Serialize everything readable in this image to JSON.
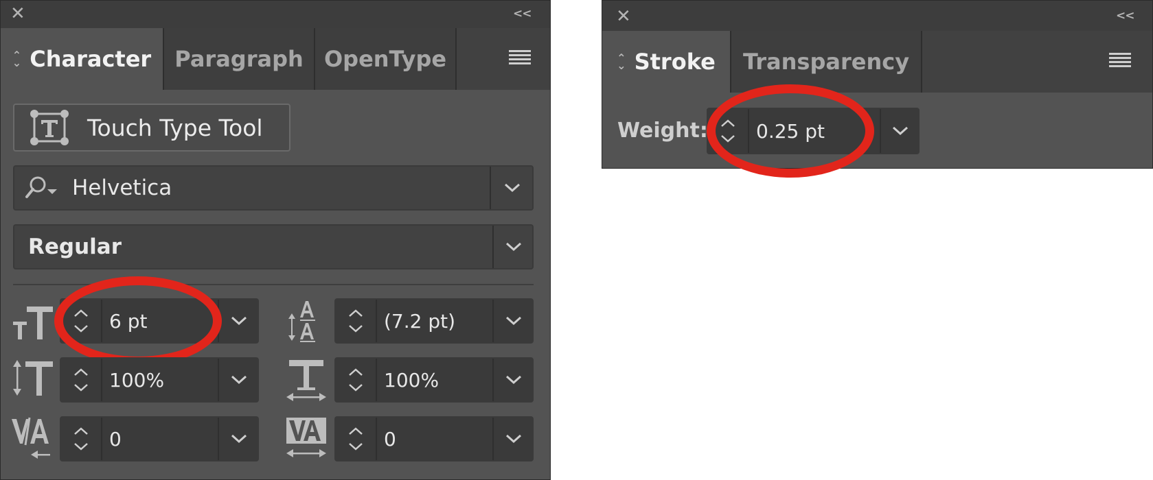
{
  "character_panel": {
    "tabs": [
      {
        "label": "Character",
        "active": true
      },
      {
        "label": "Paragraph",
        "active": false
      },
      {
        "label": "OpenType",
        "active": false
      }
    ],
    "touch_type_label": "Touch Type Tool",
    "font_family": "Helvetica",
    "font_style": "Regular",
    "font_size": "6 pt",
    "leading": "(7.2 pt)",
    "vertical_scale": "100%",
    "horizontal_scale": "100%",
    "kerning": "0",
    "tracking": "0",
    "icons": {
      "font_size": "font-size-icon",
      "leading": "leading-icon",
      "vertical_scale": "vertical-scale-icon",
      "horizontal_scale": "horizontal-scale-icon",
      "kerning": "kerning-icon",
      "tracking": "tracking-icon"
    }
  },
  "stroke_panel": {
    "tabs": [
      {
        "label": "Stroke",
        "active": true
      },
      {
        "label": "Transparency",
        "active": false
      }
    ],
    "weight_label": "Weight:",
    "weight_value": "0.25 pt"
  },
  "colors": {
    "panel_bg": "#535353",
    "highlight": "#e2251b"
  }
}
